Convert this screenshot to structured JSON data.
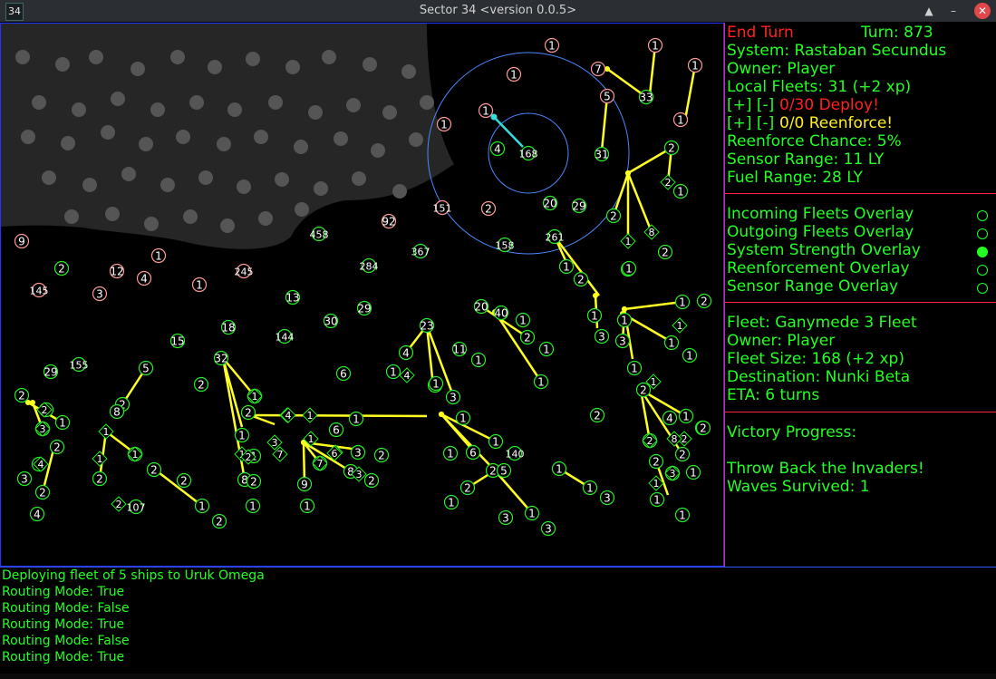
{
  "window": {
    "icon_label": "34",
    "title": "Sector 34     <version 0.0.5>",
    "buttons": [
      "▲",
      "–",
      "✕"
    ]
  },
  "side": {
    "end_turn": "End Turn",
    "turn": "Turn: 873",
    "system": "System: Rastaban Secundus",
    "owner": "Owner: Player",
    "local_fleets": "Local Fleets: 31 (+2 xp)",
    "deploy_controls": "[+]  [-]",
    "deploy_value": "0/30 Deploy!",
    "reenforce_controls": "[+]  [-]",
    "reenforce_value": "0/0 Reenforce!",
    "reenforce_chance": "Reenforce Chance: 5%",
    "sensor_range": "Sensor Range: 11 LY",
    "fuel_range": "Fuel Range: 28 LY",
    "overlays": [
      {
        "label": "Incoming Fleets Overlay",
        "on": false
      },
      {
        "label": "Outgoing Fleets Overlay",
        "on": false
      },
      {
        "label": "System Strength Overlay",
        "on": true
      },
      {
        "label": "Reenforcement Overlay",
        "on": false
      },
      {
        "label": "Sensor Range Overlay",
        "on": false
      }
    ],
    "fleet_name": "Fleet: Ganymede 3 Fleet",
    "fleet_owner": "Owner: Player",
    "fleet_size": "Fleet Size: 168 (+2 xp)",
    "destination": "Destination: Nunki Beta",
    "eta": "ETA: 6 turns",
    "victory_title": "Victory Progress:",
    "victory_goal": "Throw Back the Invaders!",
    "waves": "Waves Survived: 1"
  },
  "log": [
    "Deploying fleet of 5 ships to Uruk Omega",
    "Routing Mode: True",
    "Routing Mode: False",
    "Routing Mode: True",
    "Routing Mode: False",
    "Routing Mode: True"
  ],
  "map": {
    "colors": {
      "player": "#22ee22",
      "enemy": "#ff9999",
      "route": "#ffff22",
      "selected_route": "#33dddd",
      "range": "#4a88ff",
      "fog": "#262626",
      "fog_dot": "#555555"
    },
    "systems": [
      {
        "label": "1",
        "owner": "enemy"
      },
      {
        "label": "1",
        "owner": "enemy"
      },
      {
        "label": "1",
        "owner": "enemy"
      },
      {
        "label": "7",
        "owner": "enemy"
      },
      {
        "label": "1",
        "owner": "enemy"
      },
      {
        "label": "1",
        "owner": "enemy"
      },
      {
        "label": "1",
        "owner": "enemy"
      },
      {
        "label": "5",
        "owner": "enemy"
      },
      {
        "label": "1",
        "owner": "enemy"
      },
      {
        "label": "33",
        "owner": "player"
      },
      {
        "label": "4",
        "owner": "player"
      },
      {
        "label": "168",
        "owner": "player"
      },
      {
        "label": "31",
        "owner": "player"
      },
      {
        "label": "2",
        "owner": "player"
      },
      {
        "label": "151",
        "owner": "enemy"
      },
      {
        "label": "2",
        "owner": "enemy"
      },
      {
        "label": "20",
        "owner": "player"
      },
      {
        "label": "29",
        "owner": "player"
      },
      {
        "label": "1",
        "owner": "player"
      },
      {
        "label": "92",
        "owner": "enemy"
      },
      {
        "label": "458",
        "owner": "player"
      },
      {
        "label": "367",
        "owner": "player"
      },
      {
        "label": "158",
        "owner": "player"
      },
      {
        "label": "261",
        "owner": "player"
      },
      {
        "label": "2",
        "owner": "player"
      },
      {
        "label": "2",
        "owner": "player"
      },
      {
        "label": "9",
        "owner": "enemy"
      },
      {
        "label": "1",
        "owner": "enemy"
      },
      {
        "label": "2",
        "owner": "player"
      },
      {
        "label": "12",
        "owner": "enemy"
      },
      {
        "label": "4",
        "owner": "enemy"
      },
      {
        "label": "145",
        "owner": "enemy"
      },
      {
        "label": "3",
        "owner": "enemy"
      },
      {
        "label": "1",
        "owner": "enemy"
      },
      {
        "label": "245",
        "owner": "enemy"
      },
      {
        "label": "284",
        "owner": "player"
      },
      {
        "label": "1",
        "owner": "player"
      },
      {
        "label": "2",
        "owner": "player"
      },
      {
        "label": "1",
        "owner": "player"
      },
      {
        "label": "13",
        "owner": "player"
      },
      {
        "label": "29",
        "owner": "player"
      },
      {
        "label": "30",
        "owner": "player"
      },
      {
        "label": "18",
        "owner": "player"
      },
      {
        "label": "144",
        "owner": "player"
      },
      {
        "label": "15",
        "owner": "player"
      },
      {
        "label": "29",
        "owner": "player"
      },
      {
        "label": "155",
        "owner": "player"
      },
      {
        "label": "32",
        "owner": "player"
      },
      {
        "label": "23",
        "owner": "player"
      },
      {
        "label": "20",
        "owner": "player"
      },
      {
        "label": "40",
        "owner": "player"
      },
      {
        "label": "1",
        "owner": "player"
      },
      {
        "label": "2",
        "owner": "player"
      },
      {
        "label": "1",
        "owner": "player"
      },
      {
        "label": "4",
        "owner": "player"
      },
      {
        "label": "1",
        "owner": "player"
      },
      {
        "label": "11",
        "owner": "player"
      },
      {
        "label": "1",
        "owner": "player"
      },
      {
        "label": "6",
        "owner": "player"
      },
      {
        "label": "1",
        "owner": "player"
      },
      {
        "label": "3",
        "owner": "player"
      },
      {
        "label": "3",
        "owner": "player"
      },
      {
        "label": "2",
        "owner": "player"
      },
      {
        "label": "1",
        "owner": "player"
      },
      {
        "label": "1",
        "owner": "player"
      },
      {
        "label": "1",
        "owner": "player"
      },
      {
        "label": "2",
        "owner": "player"
      },
      {
        "label": "3",
        "owner": "player"
      },
      {
        "label": "3",
        "owner": "player"
      },
      {
        "label": "1",
        "owner": "player"
      },
      {
        "label": "1",
        "owner": "player"
      },
      {
        "label": "1",
        "owner": "player"
      },
      {
        "label": "1",
        "owner": "player"
      },
      {
        "label": "2",
        "owner": "player"
      },
      {
        "label": "4",
        "owner": "player"
      },
      {
        "label": "1",
        "owner": "player"
      },
      {
        "label": "3",
        "owner": "player"
      },
      {
        "label": "8",
        "owner": "player"
      },
      {
        "label": "2",
        "owner": "player"
      },
      {
        "label": "2",
        "owner": "player"
      },
      {
        "label": "2",
        "owner": "player"
      },
      {
        "label": "1",
        "owner": "player"
      },
      {
        "label": "3",
        "owner": "player"
      },
      {
        "label": "5",
        "owner": "player"
      },
      {
        "label": "2",
        "owner": "player"
      },
      {
        "label": "3",
        "owner": "player"
      },
      {
        "label": "2",
        "owner": "player"
      },
      {
        "label": "3",
        "owner": "player"
      },
      {
        "label": "2",
        "owner": "player"
      },
      {
        "label": "4",
        "owner": "player"
      },
      {
        "label": "2",
        "owner": "player"
      },
      {
        "label": "8",
        "owner": "player"
      },
      {
        "label": "1",
        "owner": "player"
      },
      {
        "label": "107",
        "owner": "player"
      },
      {
        "label": "2",
        "owner": "player"
      },
      {
        "label": "2",
        "owner": "player"
      },
      {
        "label": "1",
        "owner": "player"
      },
      {
        "label": "2",
        "owner": "player"
      },
      {
        "label": "1",
        "owner": "player"
      },
      {
        "label": "2",
        "owner": "player"
      },
      {
        "label": "8",
        "owner": "player"
      },
      {
        "label": "2",
        "owner": "player"
      },
      {
        "label": "1",
        "owner": "player"
      },
      {
        "label": "3",
        "owner": "player"
      },
      {
        "label": "1",
        "owner": "player"
      },
      {
        "label": "7",
        "owner": "player"
      },
      {
        "label": "9",
        "owner": "player"
      },
      {
        "label": "1",
        "owner": "player"
      },
      {
        "label": "6",
        "owner": "player"
      },
      {
        "label": "3",
        "owner": "player"
      },
      {
        "label": "2",
        "owner": "player"
      },
      {
        "label": "8",
        "owner": "player"
      },
      {
        "label": "2",
        "owner": "player"
      },
      {
        "label": "1",
        "owner": "player"
      },
      {
        "label": "1",
        "owner": "player"
      },
      {
        "label": "1",
        "owner": "player"
      },
      {
        "label": "1",
        "owner": "player"
      },
      {
        "label": "140",
        "owner": "player"
      },
      {
        "label": "6",
        "owner": "player"
      },
      {
        "label": "1",
        "owner": "player"
      },
      {
        "label": "2",
        "owner": "player"
      },
      {
        "label": "5",
        "owner": "player"
      },
      {
        "label": "2",
        "owner": "player"
      },
      {
        "label": "1",
        "owner": "player"
      },
      {
        "label": "3",
        "owner": "player"
      },
      {
        "label": "1",
        "owner": "player"
      },
      {
        "label": "3",
        "owner": "player"
      },
      {
        "label": "1",
        "owner": "player"
      },
      {
        "label": "1",
        "owner": "player"
      },
      {
        "label": "3",
        "owner": "player"
      },
      {
        "label": "2",
        "owner": "player"
      },
      {
        "label": "1",
        "owner": "player"
      },
      {
        "label": "2",
        "owner": "player"
      },
      {
        "label": "4",
        "owner": "player"
      },
      {
        "label": "1",
        "owner": "player"
      },
      {
        "label": "2",
        "owner": "player"
      },
      {
        "label": "1",
        "owner": "player"
      }
    ],
    "fleet_markers": [
      "1",
      "4",
      "3",
      "2",
      "1",
      "1",
      "1",
      "1",
      "4",
      "2",
      "1",
      "1",
      "1",
      "8",
      "2",
      "3",
      "2",
      "1",
      "8",
      "4",
      "1",
      "4",
      "2",
      "7",
      "6",
      "3",
      "7",
      "6",
      "1",
      "3",
      "2"
    ]
  }
}
